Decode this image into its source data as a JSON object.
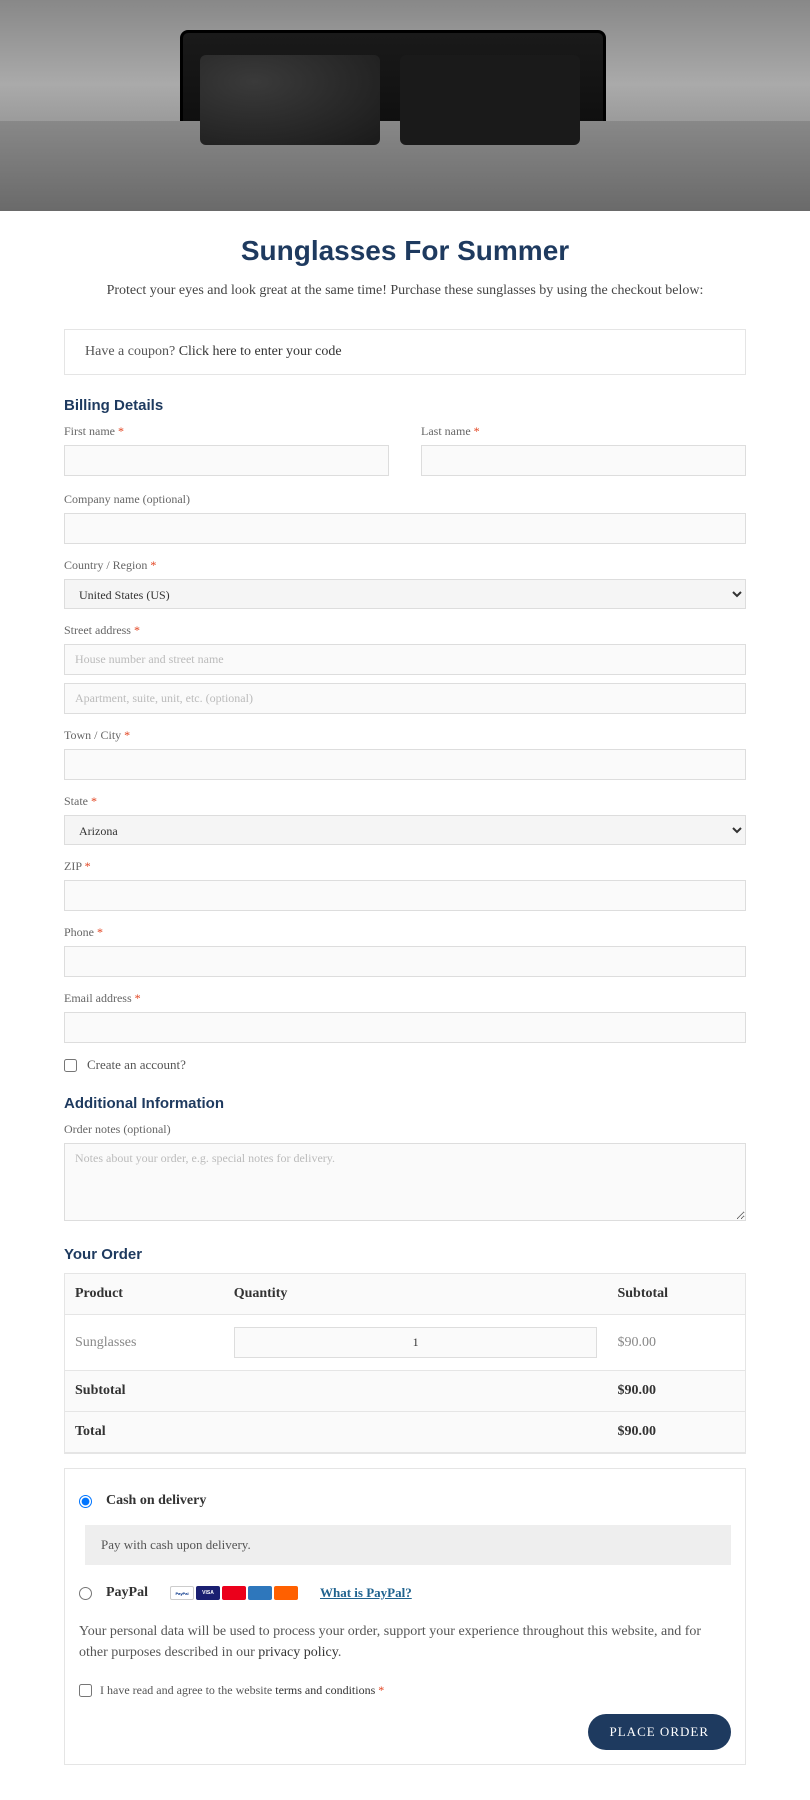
{
  "hero": {
    "title": "Sunglasses For Summer"
  },
  "intro": "Protect your eyes and look great at the same time! Purchase these sunglasses by using the checkout below:",
  "coupon": {
    "prefix": "Have a coupon? ",
    "link": "Click here to enter your code"
  },
  "billing": {
    "heading": "Billing Details",
    "first_name": "First name",
    "last_name": "Last name",
    "company": "Company name (optional)",
    "country_label": "Country / Region",
    "country_value": "United States (US)",
    "street_label": "Street address",
    "street_ph": "House number and street name",
    "apt_ph": "Apartment, suite, unit, etc. (optional)",
    "city_label": "Town / City",
    "state_label": "State",
    "state_value": "Arizona",
    "zip_label": "ZIP",
    "phone_label": "Phone",
    "email_label": "Email address",
    "create_account": "Create an account?"
  },
  "additional": {
    "heading": "Additional Information",
    "notes_label": "Order notes (optional)",
    "notes_ph": "Notes about your order, e.g. special notes for delivery."
  },
  "order": {
    "heading": "Your Order",
    "col_product": "Product",
    "col_qty": "Quantity",
    "col_subtotal": "Subtotal",
    "item_name": "Sunglasses",
    "item_qty": "1",
    "item_price": "$90.00",
    "subtotal_label": "Subtotal",
    "subtotal_value": "$90.00",
    "total_label": "Total",
    "total_value": "$90.00"
  },
  "payment": {
    "cod_label": "Cash on delivery",
    "cod_desc": "Pay with cash upon delivery.",
    "paypal_label": "PayPal",
    "paypal_help": "What is PayPal?",
    "privacy": "Your personal data will be used to process your order, support your experience throughout this website, and for other purposes described in our ",
    "privacy_link": "privacy policy",
    "privacy_suffix": ".",
    "terms_prefix": "I have read and agree to the website ",
    "terms_link": "terms and conditions",
    "place_order": "PLACE ORDER"
  }
}
